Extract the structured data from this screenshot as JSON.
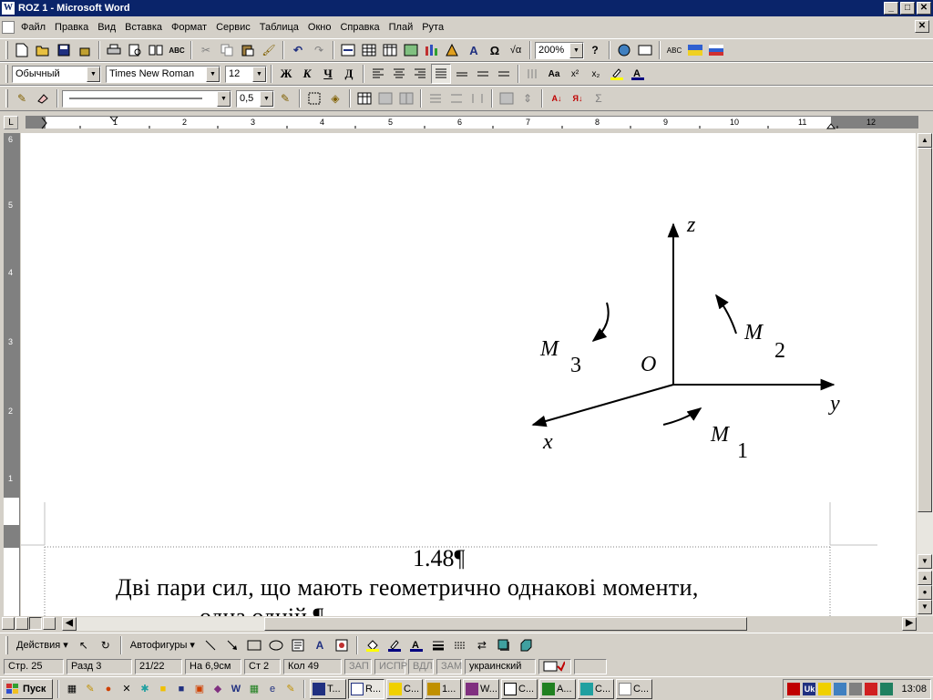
{
  "window": {
    "title": "ROZ 1 - Microsoft Word",
    "minimize": "_",
    "maximize": "□",
    "close": "✕"
  },
  "menu": [
    "Файл",
    "Правка",
    "Вид",
    "Вставка",
    "Формат",
    "Сервис",
    "Таблица",
    "Окно",
    "Справка",
    "Плай",
    "Рута"
  ],
  "toolbar_standard": {
    "zoom": "200%"
  },
  "toolbar_formatting": {
    "style": "Обычный",
    "font": "Times New Roman",
    "size": "12",
    "bold": "Ж",
    "italic": "К",
    "underline": "Ч",
    "double_underline": "Д"
  },
  "toolbar_tables": {
    "line_weight": "0,5"
  },
  "ruler": {
    "corner": "L",
    "numbers": [
      "1",
      "2",
      "3",
      "4",
      "5",
      "6",
      "7",
      "8",
      "9",
      "10",
      "11",
      "12"
    ],
    "vertical_numbers": [
      "6",
      "5",
      "4",
      "3",
      "2",
      "1"
    ]
  },
  "figure": {
    "axis_z": "z",
    "axis_y": "y",
    "axis_x": "x",
    "origin": "O",
    "m": "M",
    "m1_sub": "1",
    "m2_sub": "2",
    "m3_sub": "3"
  },
  "document": {
    "heading": "1.48¶",
    "paragraph": "Дві пари сил, що мають геометрично однакові моменти,",
    "partial_next": "одна одній ¶"
  },
  "drawing_toolbar": {
    "actions": "Действия ▾",
    "autoshapes": "Автофигуры ▾"
  },
  "status": {
    "page": "Стр. 25",
    "section": "Разд 3",
    "pages": "21/22",
    "at": "На 6,9см",
    "line": "Ст 2",
    "col": "Кол 49",
    "rec": "ЗАП",
    "trk": "ИСПР",
    "ext": "ВДЛ",
    "ovr": "ЗАМ",
    "lang": "украинский"
  },
  "taskbar": {
    "start": "Пуск",
    "tasks": [
      "T...",
      "R...",
      "C...",
      "1...",
      "W...",
      "C...",
      "A...",
      "C...",
      "C..."
    ],
    "tray_lang": "Uk",
    "clock": "13:08"
  },
  "colors": {
    "titlebar": "#0a246a",
    "face": "#d4d0c8",
    "page": "#ffffff"
  }
}
